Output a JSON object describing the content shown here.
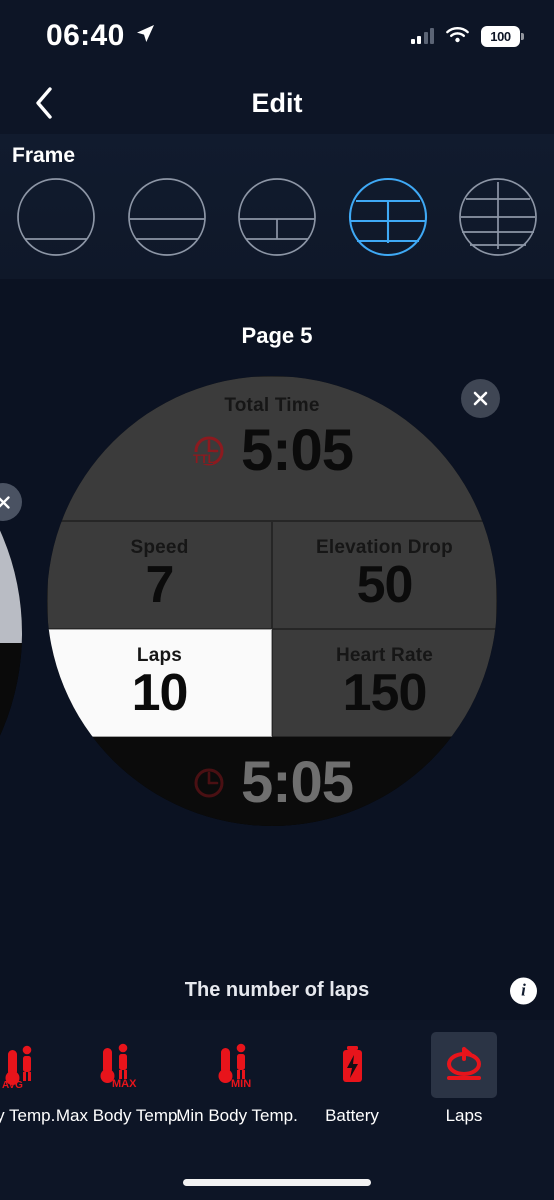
{
  "status_bar": {
    "time": "06:40",
    "location_icon": "location-arrow-icon",
    "signal_icon": "cellular-signal-icon",
    "wifi_icon": "wifi-icon",
    "battery_level": "100"
  },
  "nav": {
    "back_icon": "chevron-left-icon",
    "title": "Edit"
  },
  "frame": {
    "section_title": "Frame",
    "selected_index": 3,
    "accent_color": "#3fa9f5",
    "outline_color": "#8d96a6",
    "options": [
      {
        "name": "frame-option-1",
        "layout": "single"
      },
      {
        "name": "frame-option-2",
        "layout": "two-row"
      },
      {
        "name": "frame-option-3",
        "layout": "one-over-two"
      },
      {
        "name": "frame-option-4",
        "layout": "one-over-two-over-one"
      },
      {
        "name": "frame-option-5",
        "layout": "three-row-split"
      }
    ]
  },
  "page": {
    "label": "Page 5",
    "close_label": "×"
  },
  "watch_face": {
    "rows": [
      {
        "cells": [
          {
            "label": "Total Time",
            "value": "5:05",
            "icon": "stopwatch-ttl-icon",
            "selected": false,
            "full_width": true
          }
        ]
      },
      {
        "cells": [
          {
            "label": "Speed",
            "value": "7",
            "selected": false
          },
          {
            "label": "Elevation Drop",
            "value": "50",
            "selected": false
          }
        ]
      },
      {
        "cells": [
          {
            "label": "Laps",
            "value": "10",
            "selected": true
          },
          {
            "label": "Heart Rate",
            "value": "150",
            "selected": false
          }
        ]
      }
    ],
    "dimmed_row": {
      "value": "5:05",
      "icon": "stopwatch-ttl-icon"
    },
    "cell_bg": "#3b3b3b",
    "selected_cell_bg": "#fafafa",
    "icon_color": "#8c1a1f"
  },
  "description": {
    "text": "The number of laps",
    "info_icon_glyph": "i"
  },
  "metrics": {
    "selected": "Laps",
    "accent_color": "#e8141b",
    "items": [
      {
        "label": "dy Temp.",
        "icon": "avg-body-temp-icon",
        "selected": false,
        "clipped": true
      },
      {
        "label": "Max Body Temp.",
        "icon": "max-body-temp-icon",
        "selected": false
      },
      {
        "label": "Min Body Temp.",
        "icon": "min-body-temp-icon",
        "selected": false
      },
      {
        "label": "Battery",
        "icon": "battery-bolt-icon",
        "selected": false
      },
      {
        "label": "Laps",
        "icon": "laps-loop-icon",
        "selected": true
      }
    ]
  }
}
